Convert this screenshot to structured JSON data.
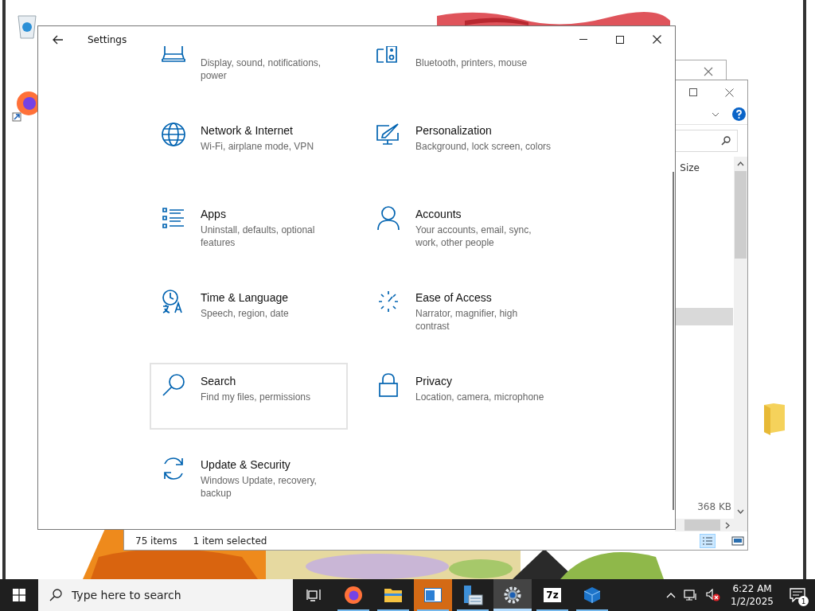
{
  "settings": {
    "title": "Settings",
    "tiles": [
      {
        "kind": "display",
        "description": "Display, sound, notifications, power",
        "selected": false
      },
      {
        "kind": "devices",
        "description": "Bluetooth, printers, mouse",
        "selected": false
      },
      {
        "kind": "globe",
        "title": "Network & Internet",
        "description": "Wi-Fi, airplane mode, VPN",
        "selected": false
      },
      {
        "kind": "personalization",
        "title": "Personalization",
        "description": "Background, lock screen, colors",
        "selected": false
      },
      {
        "kind": "apps",
        "title": "Apps",
        "description": "Uninstall, defaults, optional features",
        "selected": false
      },
      {
        "kind": "accounts",
        "title": "Accounts",
        "description": "Your accounts, email, sync, work, other people",
        "selected": false
      },
      {
        "kind": "time",
        "title": "Time & Language",
        "description": "Speech, region, date",
        "selected": false
      },
      {
        "kind": "ease",
        "title": "Ease of Access",
        "description": "Narrator, magnifier, high contrast",
        "selected": false
      },
      {
        "kind": "search",
        "title": "Search",
        "description": "Find my files, permissions",
        "selected": true
      },
      {
        "kind": "lock",
        "title": "Privacy",
        "description": "Location, camera, microphone",
        "selected": false
      },
      {
        "kind": "update",
        "title": "Update & Security",
        "description": "Windows Update, recovery, backup",
        "selected": false
      }
    ]
  },
  "explorer": {
    "column_header": "Size",
    "rows": [
      {
        "selected": true
      },
      {
        "size": "368 KB",
        "selected": false
      }
    ],
    "status_bar": [
      "75 items",
      "1 item selected"
    ]
  },
  "taskbar": {
    "search": {
      "placeholder": "Type here to search"
    },
    "apps": [
      {
        "kind": "taskview",
        "running": false,
        "selected": false,
        "attention": false
      },
      {
        "kind": "firefox",
        "running": true,
        "selected": false,
        "attention": false
      },
      {
        "kind": "explorer",
        "running": true,
        "selected": false,
        "attention": false
      },
      {
        "kind": "window",
        "running": true,
        "selected": false,
        "attention": true
      },
      {
        "kind": "server",
        "running": true,
        "selected": false,
        "attention": false
      },
      {
        "kind": "settings",
        "running": true,
        "selected": true,
        "attention": false
      },
      {
        "kind": "sevenzip",
        "label": "7z",
        "running": true,
        "selected": false,
        "attention": false
      },
      {
        "kind": "cube",
        "running": true,
        "selected": false,
        "attention": false
      }
    ],
    "time": "6:22 AM",
    "date": "1/2/2025",
    "notifications": "1"
  }
}
